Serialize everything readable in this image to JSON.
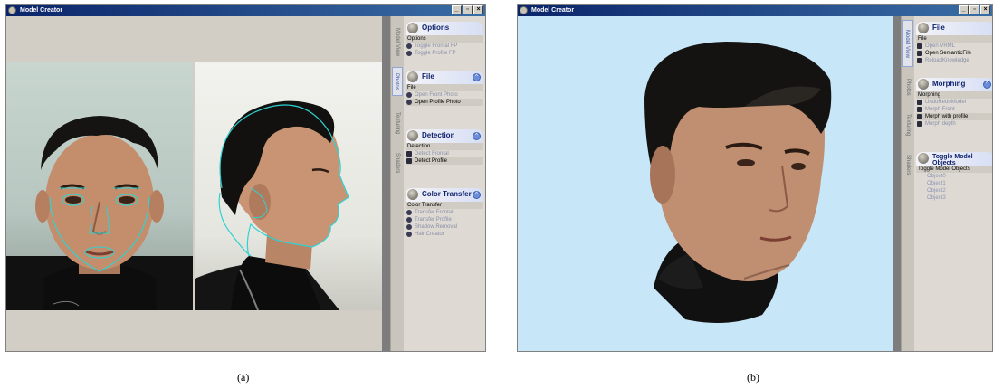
{
  "window_a": {
    "title": "Model Creator",
    "buttons": {
      "minimize": "_",
      "maximize": "▫",
      "close": "×"
    },
    "tabs": [
      "Model View",
      "Photos",
      "Texturing",
      "Shaders"
    ],
    "active_tab": "Photos",
    "groups": [
      {
        "title": "Options",
        "subtitle": "Options",
        "collapse": false,
        "items": [
          {
            "label": "Toggle Frontal FP",
            "enabled": false
          },
          {
            "label": "Toggle Profile FP",
            "enabled": false
          }
        ]
      },
      {
        "title": "File",
        "subtitle": "File",
        "collapse": true,
        "items": [
          {
            "label": "Open Front Photo",
            "enabled": false
          },
          {
            "label": "Open Profile Photo",
            "enabled": true,
            "highlight": true
          }
        ]
      },
      {
        "title": "Detection",
        "subtitle": "Detection",
        "collapse": true,
        "items": [
          {
            "label": "Detect Frontal",
            "enabled": false
          },
          {
            "label": "Detect Profile",
            "enabled": true,
            "highlight": true
          }
        ]
      },
      {
        "title": "Color Transfer",
        "subtitle": "Color Transfer",
        "collapse": true,
        "items": [
          {
            "label": "Transfer Frontal",
            "enabled": false
          },
          {
            "label": "Transfer Profile",
            "enabled": false
          },
          {
            "label": "Shadow Removal",
            "enabled": false
          },
          {
            "label": "Hair Creator",
            "enabled": false
          }
        ]
      }
    ]
  },
  "window_b": {
    "title": "Model Creator",
    "buttons": {
      "minimize": "_",
      "maximize": "▫",
      "close": "×"
    },
    "tabs": [
      "Model View",
      "Photos",
      "Texturing",
      "Shaders"
    ],
    "active_tab": "Model View",
    "groups": [
      {
        "title": "File",
        "subtitle": "File",
        "collapse": false,
        "items": [
          {
            "label": "Open VRML",
            "enabled": false
          },
          {
            "label": "Open SemanticFile",
            "enabled": true
          },
          {
            "label": "ReloadKnowledge",
            "enabled": false
          }
        ]
      },
      {
        "title": "Morphing",
        "subtitle": "Morphing",
        "collapse": true,
        "items": [
          {
            "label": "UndoRedoModel",
            "enabled": false
          },
          {
            "label": "Morph Front",
            "enabled": false
          },
          {
            "label": "Morph with profile",
            "enabled": true,
            "highlight": true
          },
          {
            "label": "Morph depth",
            "enabled": false
          }
        ]
      },
      {
        "title": "Toggle Model Objects",
        "subtitle": "Toggle Model Objects",
        "collapse": false,
        "items": [
          {
            "label": "Object0",
            "plain": true
          },
          {
            "label": "Object1",
            "plain": true
          },
          {
            "label": "Object2",
            "plain": true
          },
          {
            "label": "Object3",
            "plain": true
          }
        ]
      }
    ]
  },
  "captions": {
    "a": "(a)",
    "b": "(b)"
  },
  "colors": {
    "titlebar": "#0a246a",
    "viewport_b": "#c7e6f7",
    "fit_contour": "#2fd2d2"
  }
}
